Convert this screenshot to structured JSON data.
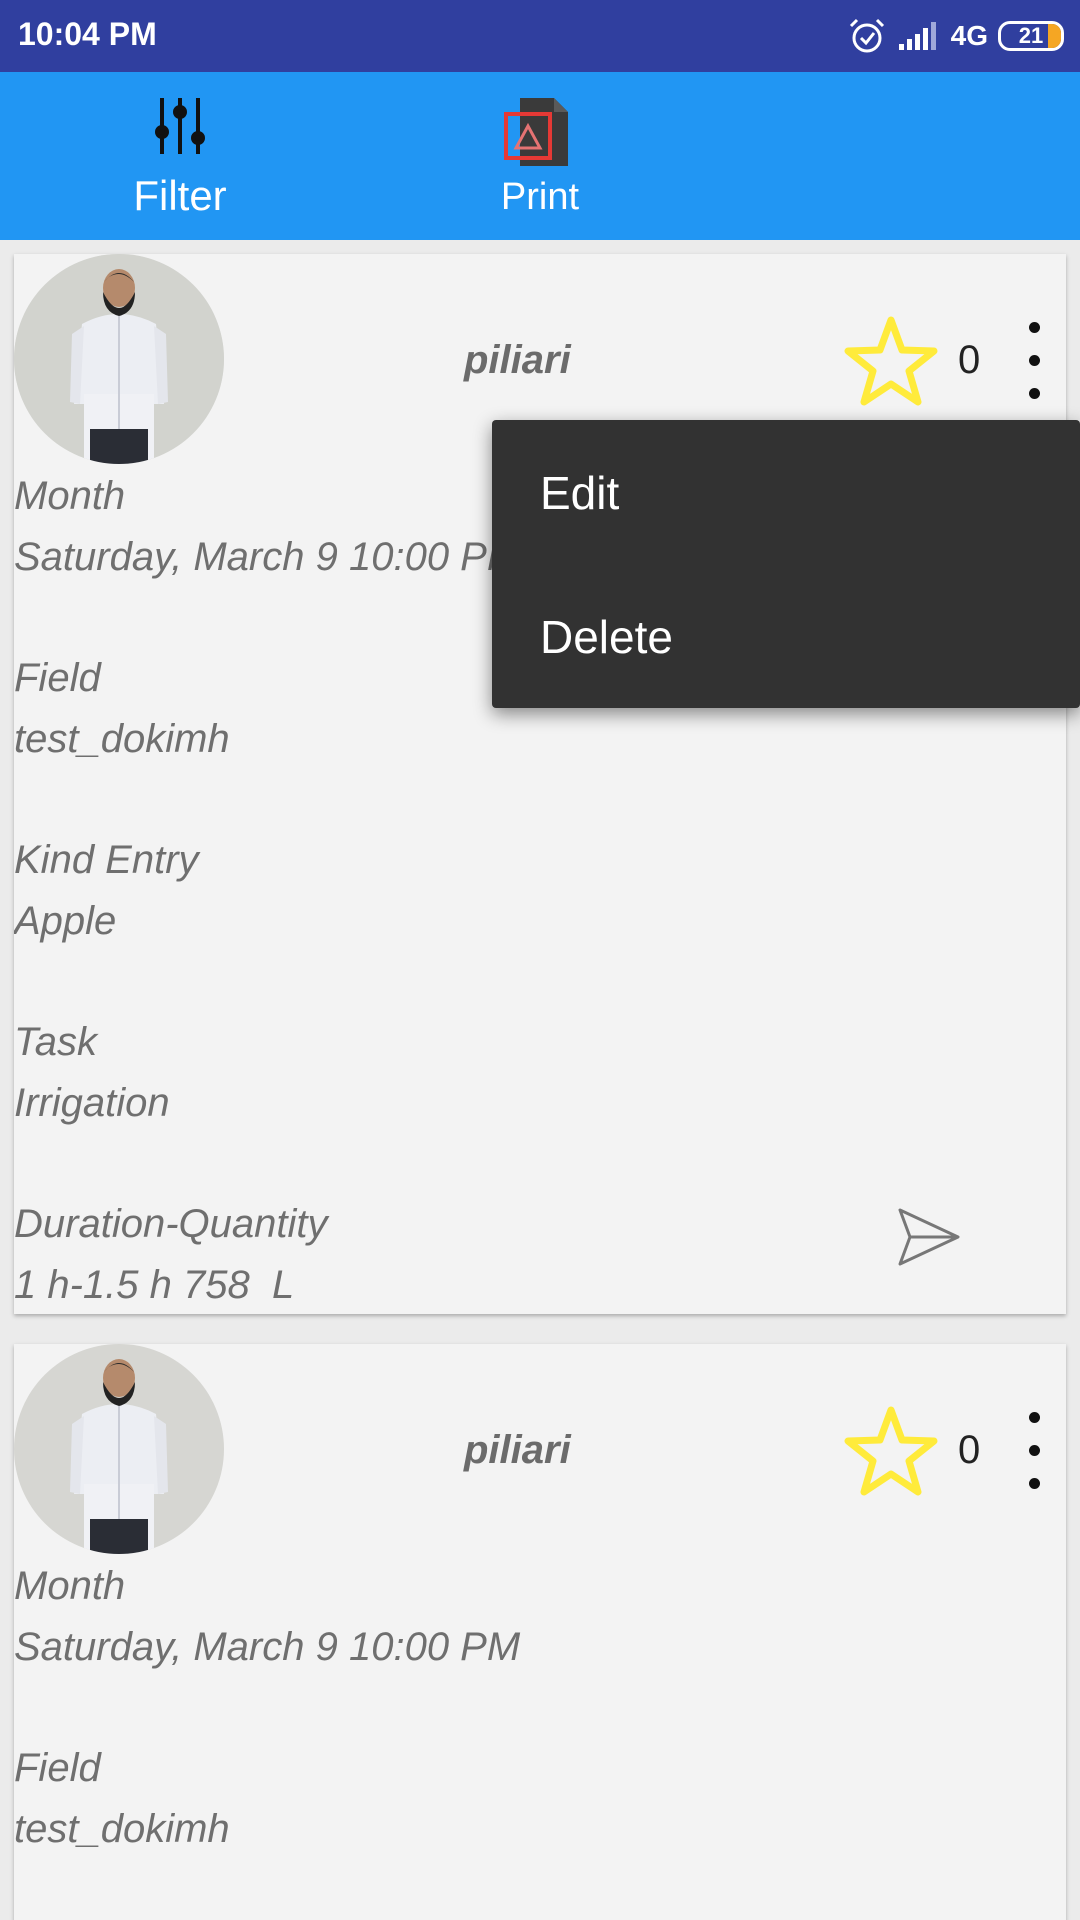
{
  "status_bar": {
    "time": "10:04 PM",
    "network": "4G",
    "battery": "21",
    "battery_level": 0.21
  },
  "toolbar": {
    "filter_label": "Filter",
    "print_label": "Print"
  },
  "posts": [
    {
      "username": "piliari",
      "star_count": "0",
      "month_label": "Month",
      "month_value": "Saturday, March 9 10:00 PM",
      "field_label": "Field",
      "field_value": "test_dokimh",
      "kind_label": "Kind Entry",
      "kind_value": "Apple",
      "task_label": "Task",
      "task_value": "Irrigation",
      "duration_label": "Duration-Quantity",
      "duration_value": "1 h-1.5 h 758  L"
    },
    {
      "username": "piliari",
      "star_count": "0",
      "month_label": "Month",
      "month_value": "Saturday, March 9 10:00 PM",
      "field_label": "Field",
      "field_value": "test_dokimh"
    }
  ],
  "popup_menu": {
    "edit": "Edit",
    "delete": "Delete"
  },
  "colors": {
    "status_bar": "#303f9f",
    "toolbar": "#2196f3",
    "star": "#ffeb3b",
    "menu_bg": "#323232"
  }
}
